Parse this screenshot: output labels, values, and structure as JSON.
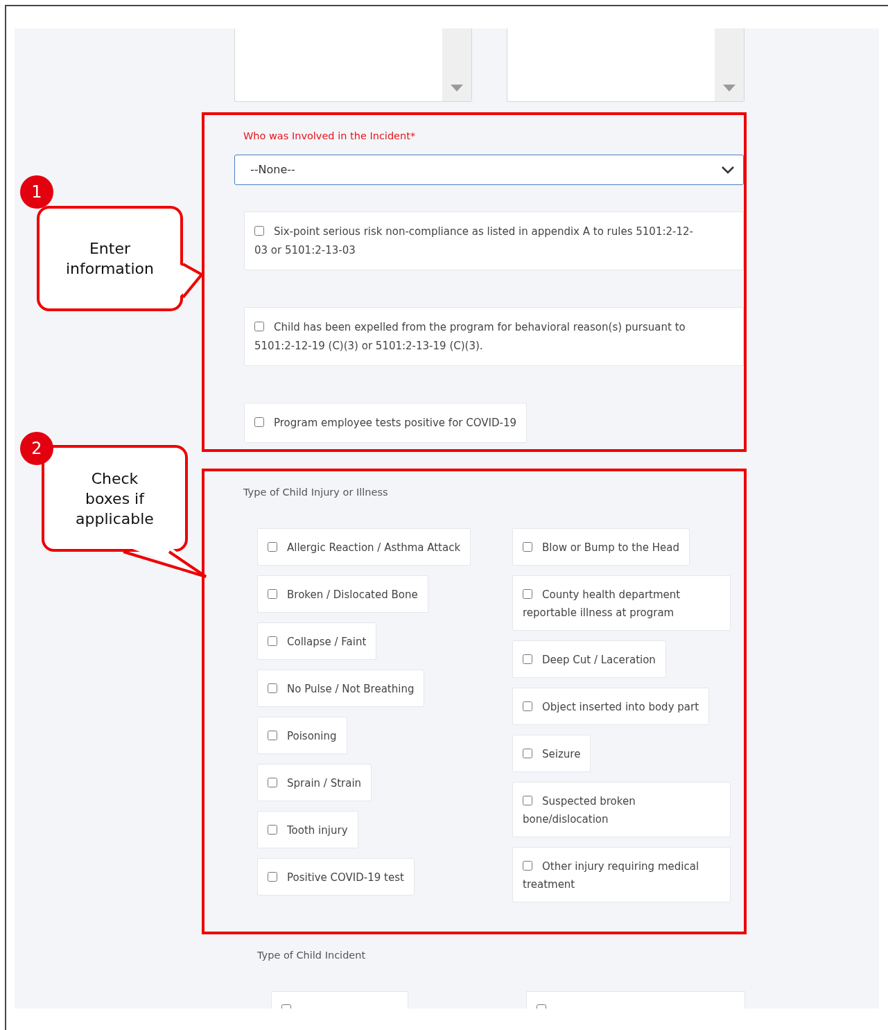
{
  "annotations": [
    {
      "number": "1",
      "text": "Enter information"
    },
    {
      "number": "2",
      "text": "Check boxes if applicable"
    }
  ],
  "involved": {
    "label": "Who was Involved in the Incident*",
    "select": {
      "value": "--None--"
    },
    "options": [
      {
        "label": "Six-point serious risk non-compliance as listed in appendix A to rules 5101:2-12-03 or 5101:2-13-03",
        "checked": false
      },
      {
        "label": "Child has been expelled from the program for behavioral reason(s) pursuant to 5101:2-12-19 (C)(3) or 5101:2-13-19 (C)(3).",
        "checked": false
      },
      {
        "label": "Program employee tests positive for COVID-19",
        "checked": false
      }
    ]
  },
  "injury": {
    "label": "Type of Child Injury or Illness",
    "left": [
      {
        "label": "Allergic Reaction / Asthma Attack",
        "checked": false
      },
      {
        "label": "Broken / Dislocated Bone",
        "checked": false
      },
      {
        "label": "Collapse / Faint",
        "checked": false
      },
      {
        "label": "No Pulse / Not Breathing",
        "checked": false
      },
      {
        "label": "Poisoning",
        "checked": false
      },
      {
        "label": "Sprain / Strain",
        "checked": false
      },
      {
        "label": "Tooth injury",
        "checked": false
      },
      {
        "label": "Positive COVID-19 test",
        "checked": false
      }
    ],
    "right": [
      {
        "label": "Blow or Bump to the Head",
        "checked": false
      },
      {
        "label": "County health department reportable illness at program",
        "checked": false
      },
      {
        "label": "Deep Cut / Laceration",
        "checked": false
      },
      {
        "label": "Object inserted into body part",
        "checked": false
      },
      {
        "label": "Seizure",
        "checked": false
      },
      {
        "label": "Suspected broken bone/dislocation",
        "checked": false
      },
      {
        "label": "Other injury requiring medical treatment",
        "checked": false
      }
    ]
  },
  "incident": {
    "label": "Type of Child Incident",
    "items": [
      {
        "checked": false
      },
      {
        "checked": false
      }
    ]
  }
}
